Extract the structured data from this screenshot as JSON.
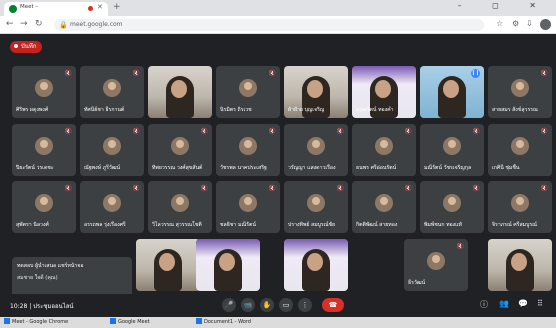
{
  "browser": {
    "tab_title": "Meet – ",
    "url": "meet.google.com",
    "window_controls": "–  ◻  ✕"
  },
  "meet": {
    "recording_label": "บันทึก",
    "participants": [
      {
        "name": "ศิริพร ผดุงพงศ์",
        "type": "avatar"
      },
      {
        "name": "ทัศนีย์ชา ธีรกานต์",
        "type": "avatar"
      },
      {
        "name": "",
        "type": "video"
      },
      {
        "name": "นิรมิตร ถิรเวช",
        "type": "avatar"
      },
      {
        "name": "ผ้าฝ้าย บุญเจริญ",
        "type": "video"
      },
      {
        "name": "อรุณรัตน์ ทองคำ",
        "type": "video-purple"
      },
      {
        "name": "",
        "type": "video-blue-speaking"
      },
      {
        "name": "สายสมร สังข์สุวรรณ",
        "type": "avatar"
      },
      {
        "name": "ปิยะรัตน์ วรเดชะ",
        "type": "avatar"
      },
      {
        "name": "ณัฐพงษ์ ภูรีวัฒน์",
        "type": "avatar"
      },
      {
        "name": "ทิพยวรรณ วงศ์สุขสันต์",
        "type": "avatar"
      },
      {
        "name": "วัชรพล นาคประเสริฐ",
        "type": "avatar"
      },
      {
        "name": "วรัญญา แสงดาวเรือง",
        "type": "avatar"
      },
      {
        "name": "ธนพร ศรีอ่อนรัตน์",
        "type": "avatar"
      },
      {
        "name": "มณีรัตน์ วัชรเจริญกุล",
        "type": "avatar"
      },
      {
        "name": "เกศินี ชุ่มชื่น",
        "type": "avatar"
      },
      {
        "name": "สุพัตรา นิลวงศ์",
        "type": "avatar"
      },
      {
        "name": "อรรถพล รุ่งเรืองศรี",
        "type": "avatar"
      },
      {
        "name": "วิไลวรรณ สุวรรณโชติ",
        "type": "avatar"
      },
      {
        "name": "ชลธิชา มณีรัตน์",
        "type": "avatar"
      },
      {
        "name": "ปรางทิพย์ สมบูรณ์ชัย",
        "type": "avatar"
      },
      {
        "name": "กิตติพัฒน์ สายทอง",
        "type": "avatar"
      },
      {
        "name": "พิมพ์ชนก ทองแท้",
        "type": "avatar"
      },
      {
        "name": "จิราภรณ์ ศรีสมบูรณ์",
        "type": "avatar"
      },
      {
        "name": "",
        "type": "video"
      },
      {
        "name": "",
        "type": "video-purple"
      },
      {
        "name": "",
        "type": "video-purple"
      },
      {
        "name": "ธีรวัฒน์",
        "type": "avatar"
      },
      {
        "name": "",
        "type": "video"
      }
    ],
    "presenting_line1": "ทดสอบ ผู้นำเสนอ แชร์หน้าจอ",
    "presenting_line2": "สมชาย ใจดี (คุณ)"
  },
  "bottom": {
    "time": "10:28 | ประชุมออนไลน์",
    "controls": [
      "🎤",
      "📹",
      "✋",
      "▭",
      "⋮"
    ],
    "end_icon": "☎",
    "right_icons": [
      "ⓘ",
      "👥",
      "💬",
      "⠿"
    ]
  },
  "taskbar": {
    "items": [
      "Meet - Google Chrome",
      "Google Meet",
      "Document1 - Word"
    ]
  }
}
